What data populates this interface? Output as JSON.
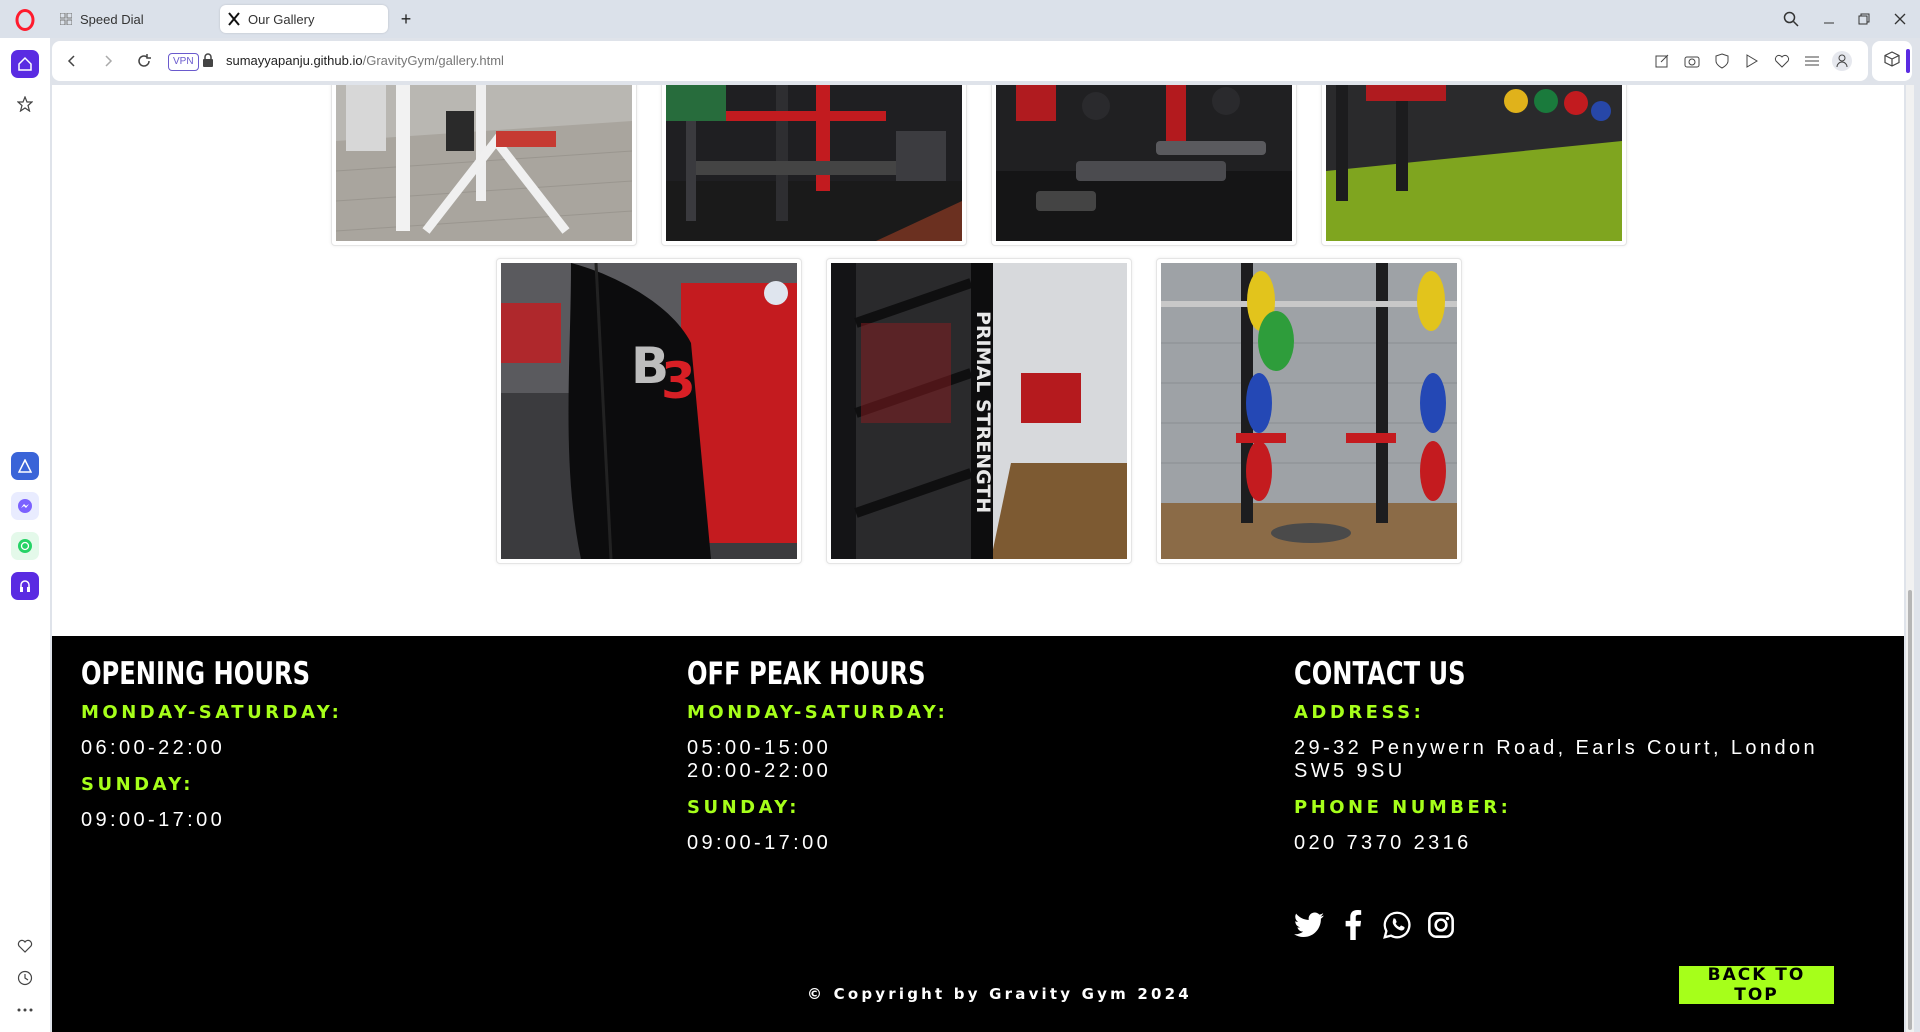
{
  "browser": {
    "tabs": [
      {
        "label": "Speed Dial",
        "icon": "grid-icon"
      },
      {
        "label": "Our Gallery",
        "icon": "gym-favicon-icon"
      }
    ],
    "vpn_label": "VPN",
    "url_host": "sumayyapanju.github.io",
    "url_path": "/GravityGym/gallery.html"
  },
  "gallery": {
    "images": [
      {
        "name": "gym-image-white-machine"
      },
      {
        "name": "gym-image-red-rack"
      },
      {
        "name": "gym-image-benches"
      },
      {
        "name": "gym-image-turf"
      },
      {
        "name": "gym-image-b3-hoodie"
      },
      {
        "name": "gym-image-primal-strength"
      },
      {
        "name": "gym-image-squat-rack"
      }
    ]
  },
  "footer": {
    "opening": {
      "title": "OPENING HOURS",
      "label1": "MONDAY-SATURDAY:",
      "value1": "06:00-22:00",
      "label2": "SUNDAY:",
      "value2": "09:00-17:00"
    },
    "offpeak": {
      "title": "OFF PEAK HOURS",
      "label1": "MONDAY-SATURDAY:",
      "value1a": "05:00-15:00",
      "value1b": "20:00-22:00",
      "label2": "SUNDAY:",
      "value2": "09:00-17:00"
    },
    "contact": {
      "title": "CONTACT US",
      "label1": "ADDRESS:",
      "value1": "29-32 Penywern Road, Earls Court, London SW5 9SU",
      "label2": "PHONE NUMBER:",
      "value2": "020 7370 2316"
    },
    "socials": [
      "twitter-icon",
      "facebook-icon",
      "whatsapp-icon",
      "instagram-icon"
    ],
    "copyright": "© Copyright by Gravity Gym 2024",
    "back_to_top": "BACK TO TOP"
  },
  "colors": {
    "accent": "#a6ff1a",
    "footer_bg": "#000000",
    "opera_red": "#ff1b2d",
    "sidebar_accent": "#5a2be2"
  }
}
